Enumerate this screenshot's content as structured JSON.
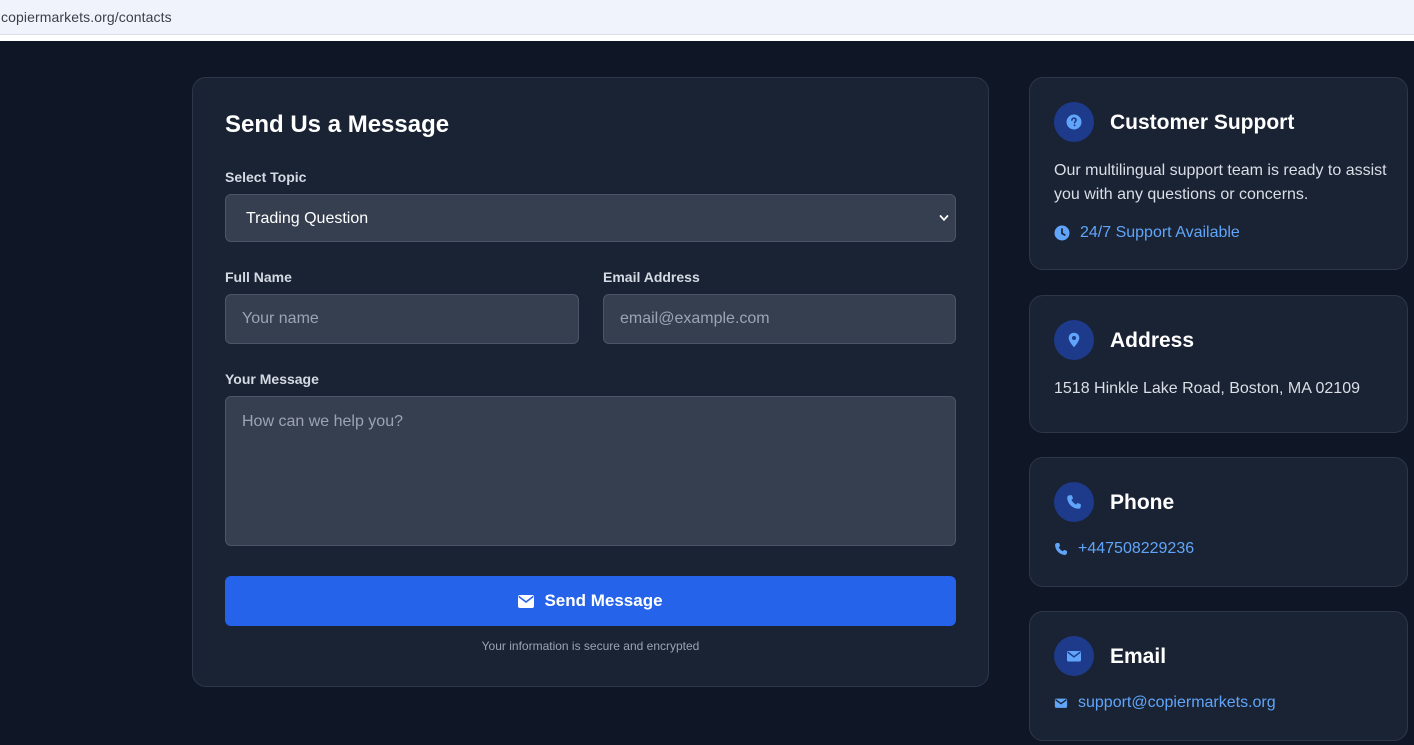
{
  "browser": {
    "url": "copiermarkets.org/contacts"
  },
  "form": {
    "title": "Send Us a Message",
    "topic_label": "Select Topic",
    "topic_value": "Trading Question",
    "name_label": "Full Name",
    "name_placeholder": "Your name",
    "email_label": "Email Address",
    "email_placeholder": "email@example.com",
    "message_label": "Your Message",
    "message_placeholder": "How can we help you?",
    "submit_label": "Send Message",
    "secure_note": "Your information is secure and encrypted"
  },
  "support": {
    "title": "Customer Support",
    "description": "Our multilingual support team is ready to assist you with any questions or concerns.",
    "availability": "24/7 Support Available"
  },
  "address": {
    "title": "Address",
    "text": "1518 Hinkle Lake Road, Boston, MA 02109"
  },
  "phone": {
    "title": "Phone",
    "number": "+447508229236"
  },
  "email": {
    "title": "Email",
    "address": "support@copiermarkets.org"
  },
  "icons": {
    "support": "question-circle-icon",
    "availability": "clock-icon",
    "address": "map-pin-icon",
    "phone": "phone-icon",
    "email": "envelope-icon",
    "submit": "envelope-icon",
    "select": "chevron-down-icon"
  },
  "colors": {
    "background": "#0f1625",
    "card": "#1a2333",
    "accent": "#2563eb",
    "link": "#60a5fa",
    "icon_bg": "#1e3a8a"
  }
}
